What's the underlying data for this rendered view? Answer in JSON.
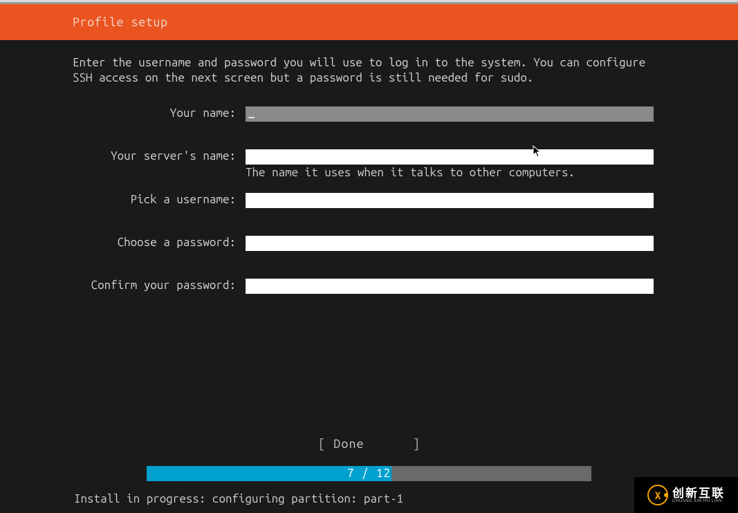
{
  "header": {
    "title": "Profile setup"
  },
  "intro": "Enter the username and password you will use to log in to the system. You can configure SSH access on the next screen but a password is still needed for sudo.",
  "fields": {
    "name": {
      "label": "Your name:",
      "value": ""
    },
    "servername": {
      "label": "Your server's name:",
      "value": "",
      "hint": "The name it uses when it talks to other computers."
    },
    "username": {
      "label": "Pick a username:",
      "value": ""
    },
    "password": {
      "label": "Choose a password:",
      "value": ""
    },
    "confirm": {
      "label": "Confirm your password:",
      "value": ""
    }
  },
  "button": {
    "done": "Done"
  },
  "progress": {
    "current": 7,
    "total": 12,
    "text": "7 / 12",
    "percent": 55
  },
  "status": "Install in progress: configuring partition: part-1",
  "watermark": {
    "logo_letter": "X",
    "text_big": "创新互联",
    "text_small": "CHUANG XIN HU LIAN"
  }
}
